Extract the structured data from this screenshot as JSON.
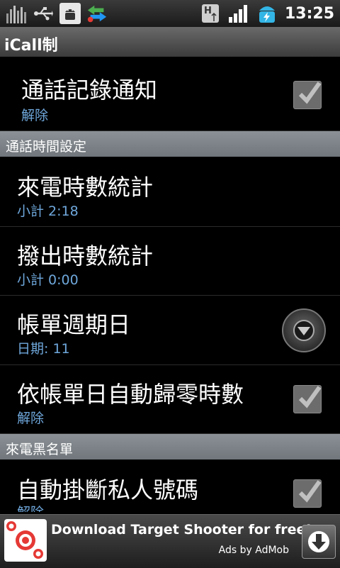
{
  "status_bar": {
    "time": "13:25",
    "icons": [
      "equalizer-icon",
      "usb-icon",
      "android-debug-icon",
      "sync-arrows-icon",
      "h-data-icon",
      "signal-icon",
      "battery-charging-icon"
    ]
  },
  "app": {
    "title": "iCall制"
  },
  "items": [
    {
      "title": "通話記錄通知",
      "summary": "解除",
      "widget": "checkbox",
      "checked": true
    },
    {
      "header": "通話時間設定"
    },
    {
      "title": "來電時數統計",
      "summary": "小計 2:18"
    },
    {
      "title": "撥出時數統計",
      "summary": "小計 0:00"
    },
    {
      "title": "帳單週期日",
      "summary": "日期: 11",
      "widget": "dropdown"
    },
    {
      "title": "依帳單日自動歸零時數",
      "summary": "解除",
      "widget": "checkbox",
      "checked": true
    },
    {
      "header": "來電黑名單"
    },
    {
      "title": "自動掛斷私人號碼",
      "summary": "解除",
      "widget": "checkbox",
      "checked": true
    }
  ],
  "ad": {
    "headline": "Download Target Shooter for free!",
    "attribution": "Ads by AdMob",
    "icon": "target-icon",
    "action_icon": "download-icon"
  },
  "colors": {
    "summary": "#6fa8dc",
    "header_bg": "#7d8388",
    "check_bg": "#6c6c6c"
  }
}
